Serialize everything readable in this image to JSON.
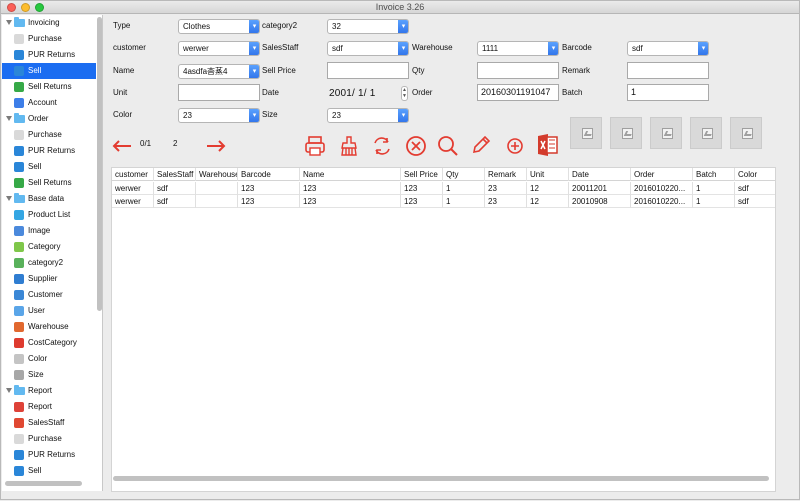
{
  "window": {
    "title": "Invoice 3.26"
  },
  "sidebar": {
    "items": [
      {
        "label": "Invoicing",
        "type": "group",
        "icon": "folder-icon",
        "color": "#62b9f0"
      },
      {
        "label": "Purchase",
        "type": "item",
        "icon": "purchase-icon",
        "color": "#d9d9d9"
      },
      {
        "label": "PUR Returns",
        "type": "item",
        "icon": "globe-icon",
        "color": "#2a86d8"
      },
      {
        "label": "Sell",
        "type": "item",
        "icon": "globe-icon",
        "color": "#2a86d8",
        "selected": true
      },
      {
        "label": "Sell Returns",
        "type": "item",
        "icon": "refresh-icon",
        "color": "#36a947"
      },
      {
        "label": "Account",
        "type": "item",
        "icon": "account-icon",
        "color": "#3d7ee8"
      },
      {
        "label": "Order",
        "type": "group",
        "icon": "folder-icon",
        "color": "#62b9f0"
      },
      {
        "label": "Purchase",
        "type": "item",
        "icon": "purchase-icon",
        "color": "#d9d9d9"
      },
      {
        "label": "PUR Returns",
        "type": "item",
        "icon": "globe-icon",
        "color": "#2a86d8"
      },
      {
        "label": "Sell",
        "type": "item",
        "icon": "globe-icon",
        "color": "#2a86d8"
      },
      {
        "label": "Sell Returns",
        "type": "item",
        "icon": "refresh-icon",
        "color": "#36a947"
      },
      {
        "label": "Base data",
        "type": "group",
        "icon": "folder-icon",
        "color": "#62b9f0"
      },
      {
        "label": "Product List",
        "type": "item",
        "icon": "chart-icon",
        "color": "#34a6e3"
      },
      {
        "label": "Image",
        "type": "item",
        "icon": "image-icon",
        "color": "#4b89dc"
      },
      {
        "label": "Category",
        "type": "item",
        "icon": "category-icon",
        "color": "#7fc74a"
      },
      {
        "label": "category2",
        "type": "item",
        "icon": "category-icon",
        "color": "#59b15b"
      },
      {
        "label": "Supplier",
        "type": "item",
        "icon": "supplier-icon",
        "color": "#2f7dd1"
      },
      {
        "label": "Customer",
        "type": "item",
        "icon": "customer-icon",
        "color": "#3a87d6"
      },
      {
        "label": "User",
        "type": "item",
        "icon": "user-icon",
        "color": "#5aa5e8"
      },
      {
        "label": "Warehouse",
        "type": "item",
        "icon": "warehouse-icon",
        "color": "#e1682f"
      },
      {
        "label": "CostCategory",
        "type": "item",
        "icon": "costcategory-icon",
        "color": "#de3b2f"
      },
      {
        "label": "Color",
        "type": "item",
        "icon": "color-icon",
        "color": "#c4c4c4"
      },
      {
        "label": "Size",
        "type": "item",
        "icon": "size-icon",
        "color": "#a7a7a7"
      },
      {
        "label": "Report",
        "type": "group",
        "icon": "folder-icon",
        "color": "#62b9f0"
      },
      {
        "label": "Report",
        "type": "item",
        "icon": "report-icon",
        "color": "#de4238"
      },
      {
        "label": "SalesStaff",
        "type": "item",
        "icon": "salesstaff-icon",
        "color": "#e04832"
      },
      {
        "label": "Purchase",
        "type": "item",
        "icon": "purchase-icon",
        "color": "#d9d9d9"
      },
      {
        "label": "PUR Returns",
        "type": "item",
        "icon": "globe-icon",
        "color": "#2a86d8"
      },
      {
        "label": "Sell",
        "type": "item",
        "icon": "globe-icon",
        "color": "#2a86d8"
      }
    ]
  },
  "form": {
    "type": {
      "label": "Type",
      "value": "Clothes"
    },
    "category2": {
      "label": "category2",
      "value": "32"
    },
    "customer": {
      "label": "customer",
      "value": "werwer"
    },
    "salesstaff": {
      "label": "SalesStaff",
      "value": "sdf"
    },
    "warehouse": {
      "label": "Warehouse",
      "value": "1111"
    },
    "barcode": {
      "label": "Barcode",
      "value": "sdf"
    },
    "name": {
      "label": "Name",
      "value": "4asdfa杳蒸4"
    },
    "sellprice": {
      "label": "Sell Price",
      "value": ""
    },
    "qty": {
      "label": "Qty",
      "value": ""
    },
    "remark": {
      "label": "Remark",
      "value": ""
    },
    "unit": {
      "label": "Unit",
      "value": ""
    },
    "date": {
      "label": "Date",
      "value": "2001/  1/  1"
    },
    "order": {
      "label": "Order",
      "value": "20160301191047"
    },
    "batch": {
      "label": "Batch",
      "value": "1"
    },
    "color": {
      "label": "Color",
      "value": "23"
    },
    "size": {
      "label": "Size",
      "value": "23"
    }
  },
  "pager": {
    "current": "0/1",
    "count": "2"
  },
  "colors": {
    "accent": "#1b6df1",
    "action_red": "#e33c31",
    "excel_red": "#d33b2c"
  },
  "table": {
    "columns": [
      "customer",
      "SalesStaff",
      "Warehouse",
      "Barcode",
      "Name",
      "Sell Price",
      "Qty",
      "Remark",
      "Unit",
      "Date",
      "Order",
      "Batch",
      "Color"
    ],
    "rows": [
      [
        "werwer",
        "sdf",
        "",
        "123",
        "123",
        "123",
        "1",
        "23",
        "12",
        "20011201",
        "2016010220...",
        "1",
        "sdf"
      ],
      [
        "werwer",
        "sdf",
        "",
        "123",
        "123",
        "123",
        "1",
        "23",
        "12",
        "20010908",
        "2016010220...",
        "1",
        "sdf"
      ]
    ]
  }
}
